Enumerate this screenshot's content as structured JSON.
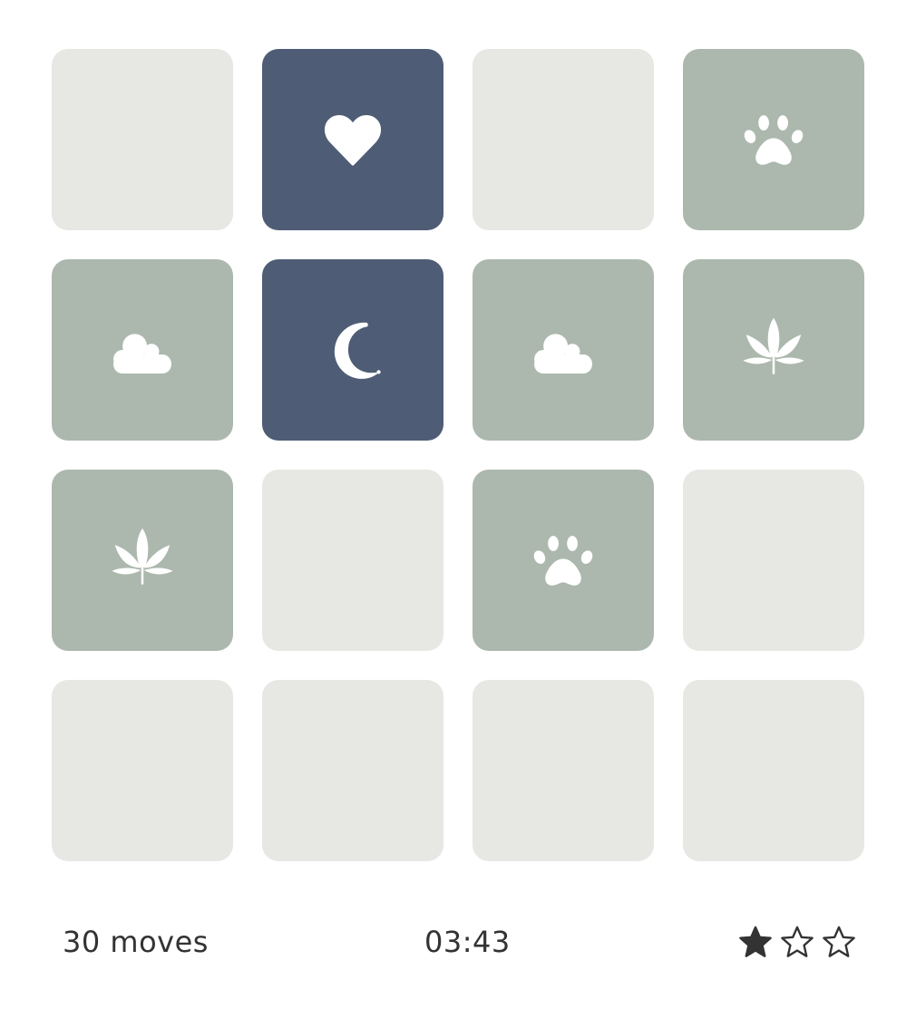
{
  "board": {
    "rows": 4,
    "columns": 4,
    "cards": [
      {
        "state": "hidden",
        "icon": ""
      },
      {
        "state": "flipped",
        "icon": "heart-icon"
      },
      {
        "state": "hidden",
        "icon": ""
      },
      {
        "state": "matched",
        "icon": "paw-icon"
      },
      {
        "state": "matched",
        "icon": "cloud-icon"
      },
      {
        "state": "flipped",
        "icon": "moon-icon"
      },
      {
        "state": "matched",
        "icon": "cloud-icon"
      },
      {
        "state": "matched",
        "icon": "leaf-icon"
      },
      {
        "state": "matched",
        "icon": "leaf-icon"
      },
      {
        "state": "hidden",
        "icon": ""
      },
      {
        "state": "matched",
        "icon": "paw-icon"
      },
      {
        "state": "hidden",
        "icon": ""
      },
      {
        "state": "hidden",
        "icon": ""
      },
      {
        "state": "hidden",
        "icon": ""
      },
      {
        "state": "hidden",
        "icon": ""
      },
      {
        "state": "hidden",
        "icon": ""
      }
    ]
  },
  "status": {
    "moves": "30 moves",
    "timer": "03:43",
    "stars": {
      "filled": 1,
      "total": 3
    }
  },
  "colors": {
    "hidden_card": "#e7e7e4",
    "matched_card": "#acb8ad",
    "flipped_card": "#4e5d75",
    "icon": "#ffffff",
    "text": "#333333"
  }
}
